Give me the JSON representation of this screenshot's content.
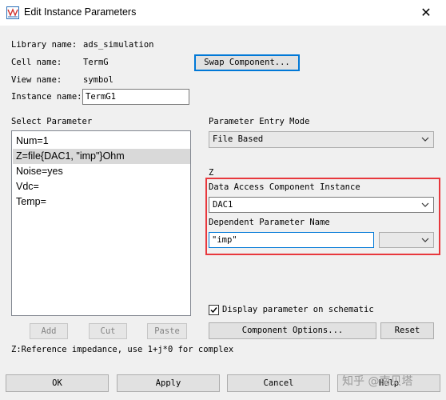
{
  "window": {
    "title": "Edit Instance Parameters",
    "close_glyph": "✕",
    "icon": "ads-app-icon"
  },
  "info": {
    "library_label": "Library name:",
    "library_value": "ads_simulation",
    "cell_label": "Cell name:",
    "cell_value": "TermG",
    "view_label": "View name:",
    "view_value": "symbol",
    "instance_label": "Instance name:",
    "instance_value": "TermG1",
    "swap_button": "Swap Component..."
  },
  "select_parameter": {
    "heading": "Select Parameter",
    "items": [
      {
        "label": "Num=1"
      },
      {
        "label": "Z=file{DAC1, \"imp\"}Ohm",
        "selected": true
      },
      {
        "label": "Noise=yes"
      },
      {
        "label": "Vdc="
      },
      {
        "label": "Temp="
      }
    ],
    "add_button": "Add",
    "cut_button": "Cut",
    "paste_button": "Paste"
  },
  "entry_mode": {
    "heading": "Parameter Entry Mode",
    "value": "File Based"
  },
  "param_name": "Z",
  "dac_group": {
    "dac_label": "Data Access Component Instance",
    "dac_value": "DAC1",
    "dep_label": "Dependent Parameter Name",
    "dep_value": "\"imp\"",
    "dep_combo_value": ""
  },
  "display_checkbox": {
    "label": "Display parameter on schematic",
    "checked": true
  },
  "component_options_button": "Component Options...",
  "reset_button": "Reset",
  "description": "Z:Reference impedance, use 1+j*0 for complex",
  "footer": {
    "ok": "OK",
    "apply": "Apply",
    "cancel": "Cancel",
    "help": "Help"
  },
  "watermark": "知乎 @南贝塔",
  "colors": {
    "accent": "#0078d7",
    "highlight_box": "#e8383d",
    "selected_row": "#d9d9d9"
  }
}
